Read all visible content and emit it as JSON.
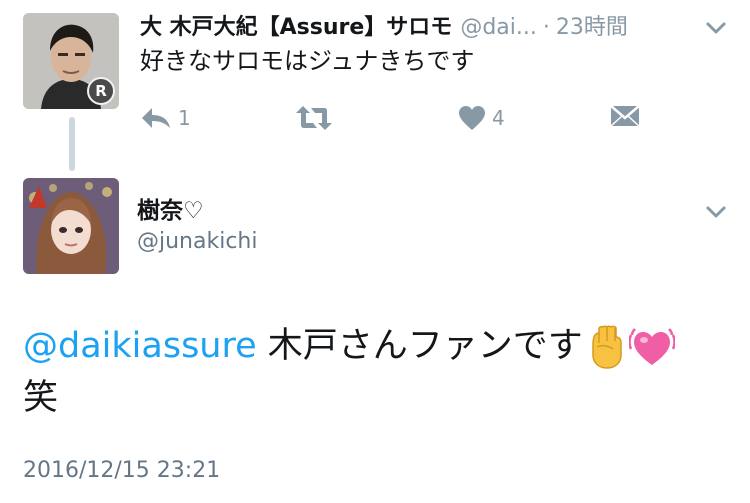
{
  "tweet1": {
    "display_name": "大 木戸大紀【Assure】サロモ",
    "handle": "@dai...",
    "separator": "·",
    "time": "23時間",
    "text": "好きなサロモはジュナきちです",
    "reply_count": "1",
    "like_count": "4",
    "avatar_badge": "R"
  },
  "tweet2": {
    "display_name": "樹奈♡",
    "handle": "@junakichi",
    "mention": "@daikiassure",
    "text": " 木戸さんファンです",
    "text_line2": "笑",
    "timestamp": "2016/12/15 23:21"
  },
  "colors": {
    "accent": "#1da1f2",
    "muted": "#8899a6",
    "like_color": "#8899a6"
  },
  "icons": {
    "reply": "reply-icon",
    "retweet": "retweet-icon",
    "like": "heart-icon",
    "dm": "direct-message-icon",
    "more": "chevron-down-icon"
  }
}
